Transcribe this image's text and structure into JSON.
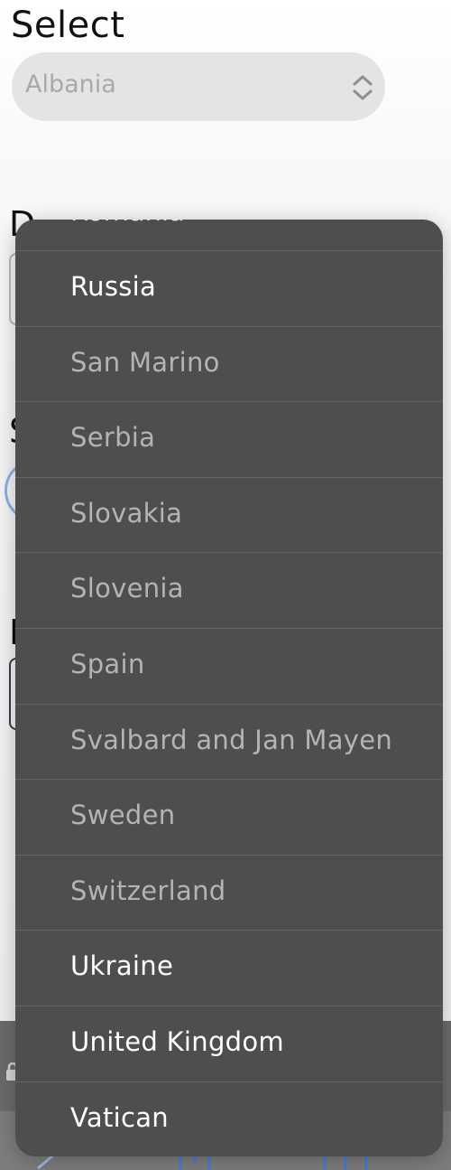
{
  "page": {
    "title": "Select",
    "partial_labels": [
      "D",
      "S",
      "I"
    ]
  },
  "select": {
    "value": "Albania"
  },
  "dropdown": {
    "partial_option": "Romania",
    "options": [
      {
        "label": "Russia",
        "enabled": true
      },
      {
        "label": "San Marino",
        "enabled": false
      },
      {
        "label": "Serbia",
        "enabled": false
      },
      {
        "label": "Slovakia",
        "enabled": false
      },
      {
        "label": "Slovenia",
        "enabled": false
      },
      {
        "label": "Spain",
        "enabled": false
      },
      {
        "label": "Svalbard and Jan Mayen",
        "enabled": false
      },
      {
        "label": "Sweden",
        "enabled": false
      },
      {
        "label": "Switzerland",
        "enabled": false
      },
      {
        "label": "Ukraine",
        "enabled": true
      },
      {
        "label": "United Kingdom",
        "enabled": true
      },
      {
        "label": "Vatican",
        "enabled": true
      }
    ]
  },
  "icons": {
    "select_chevron": "chevron-up-down-icon",
    "lock": "lock-icon",
    "share": "share-icon",
    "bookmarks": "book-icon"
  },
  "colors": {
    "dropdown_bg": "#4e4e4e",
    "option_enabled": "#ffffff",
    "option_disabled": "#b4b4b4",
    "select_bg": "#e4e4e4"
  }
}
